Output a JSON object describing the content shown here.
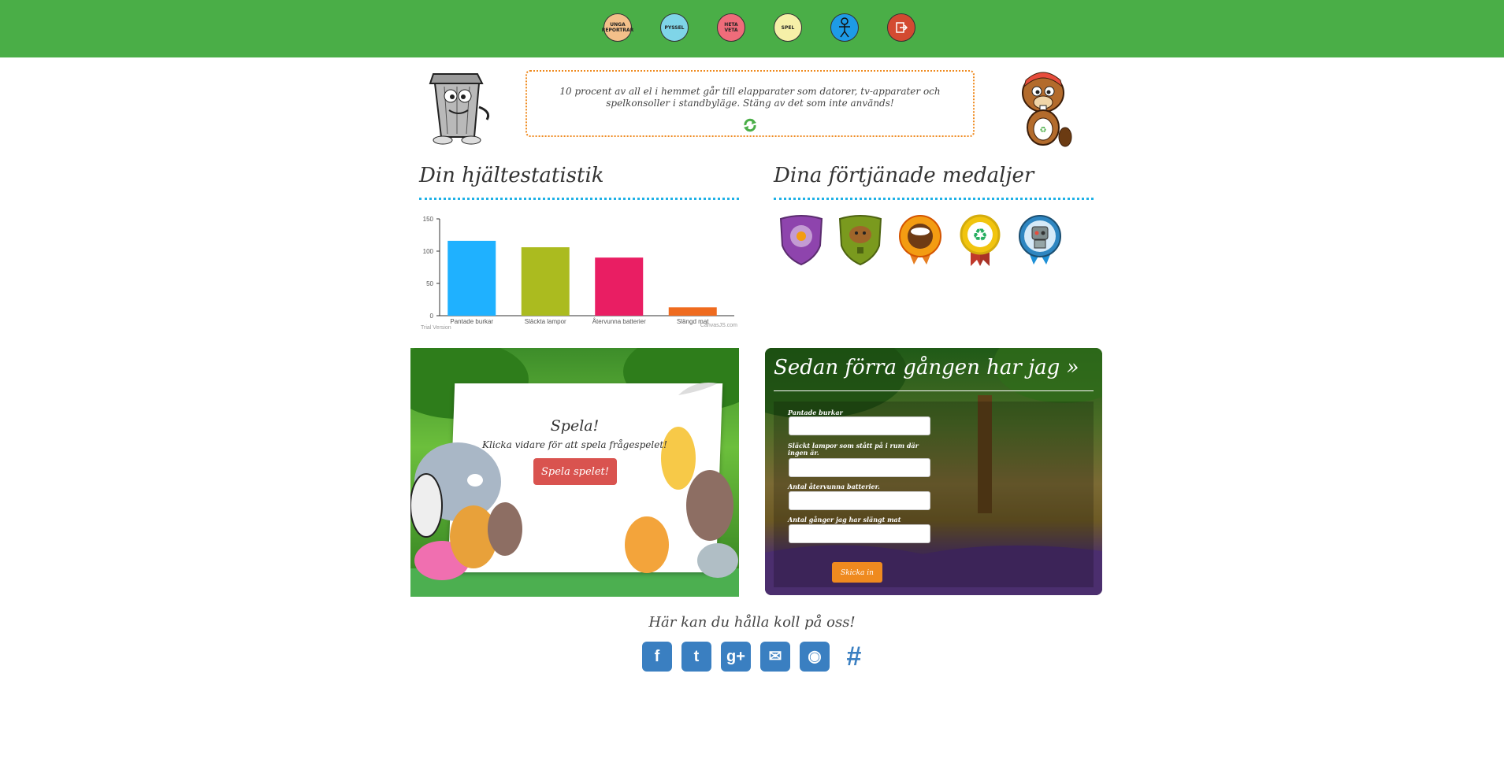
{
  "nav": {
    "icons": [
      {
        "name": "unga-reportrar-icon",
        "text": "UNGA REPORTRAR",
        "bg": "#f3c08a"
      },
      {
        "name": "pyssel-icon",
        "text": "PYSSEL",
        "bg": "#7fd5e8"
      },
      {
        "name": "heta-veta-icon",
        "text": "HETA VETA",
        "bg": "#ef6c7a"
      },
      {
        "name": "spel-icon",
        "text": "SPEL",
        "bg": "#f6f0a8"
      },
      {
        "name": "profile-icon",
        "text": "",
        "bg": "#1e9be6"
      },
      {
        "name": "logout-icon",
        "text": "",
        "bg": "#d34a31"
      }
    ]
  },
  "tip": {
    "text": "10 procent av all el i hemmet går till elapparater som datorer, tv-apparater och spelkonsoller i standbyläge. Stäng av det som inte används!"
  },
  "stats": {
    "title": "Din hjältestatistik"
  },
  "medals": {
    "title": "Dina förtjänade medaljer"
  },
  "chart_data": {
    "type": "bar",
    "categories": [
      "Pantade burkar",
      "Släckta lampor",
      "Återvunna batterier",
      "Slängd mat"
    ],
    "values": [
      116,
      106,
      90,
      13
    ],
    "colors": [
      "#1fb1ff",
      "#abbb1f",
      "#e91e63",
      "#ef6b1f"
    ],
    "ylim": [
      0,
      150
    ],
    "yticks": [
      0,
      50,
      100,
      150
    ],
    "grid": false,
    "watermark_left": "Trial Version",
    "watermark_right": "CanvasJS.com"
  },
  "game": {
    "title": "Spela!",
    "subtitle": "Klicka vidare för att spela frågespelet!",
    "button": "Spela spelet!"
  },
  "form": {
    "title": "Sedan förra gången har jag »",
    "fields": [
      {
        "label": "Pantade burkar"
      },
      {
        "label": "Släckt lampor som stått på i rum där ingen är."
      },
      {
        "label": "Antal återvunna batterier."
      },
      {
        "label": "Antal gånger jag har slängt mat"
      }
    ],
    "submit": "Skicka in"
  },
  "footer": {
    "follow_text": "Här kan du hålla koll på oss!",
    "social": [
      {
        "name": "facebook-icon",
        "glyph": "f"
      },
      {
        "name": "twitter-icon",
        "glyph": "t"
      },
      {
        "name": "google-plus-icon",
        "glyph": "g+"
      },
      {
        "name": "email-icon",
        "glyph": "✉"
      },
      {
        "name": "github-icon",
        "glyph": "◉"
      },
      {
        "name": "hashtag-icon",
        "glyph": "#"
      }
    ]
  }
}
